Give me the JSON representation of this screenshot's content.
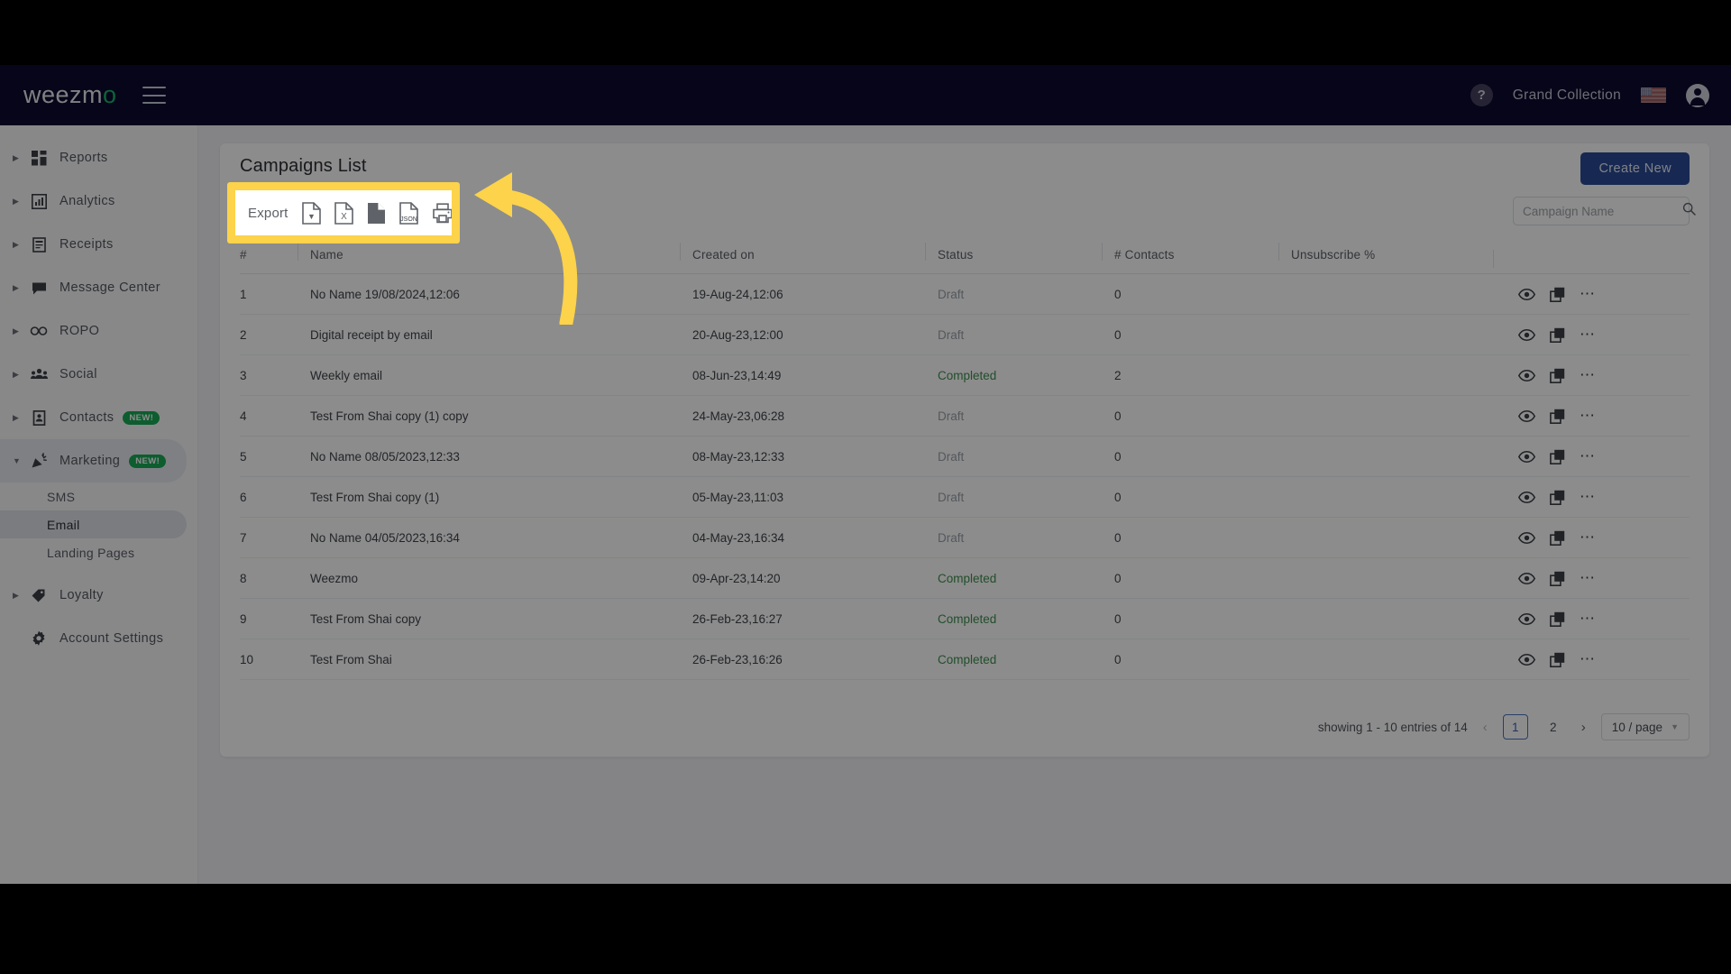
{
  "header": {
    "logo_text": "weezm",
    "logo_accent": "o",
    "menu_icon": "hamburger-icon",
    "help_icon": "?",
    "account_name": "Grand Collection",
    "flag_icon": "us-flag-icon",
    "avatar_icon": "user-avatar-icon"
  },
  "sidebar": {
    "items": [
      {
        "label": "Reports",
        "icon": "grid-icon",
        "expandable": true,
        "badge": ""
      },
      {
        "label": "Analytics",
        "icon": "bar-chart-icon",
        "expandable": true,
        "badge": ""
      },
      {
        "label": "Receipts",
        "icon": "receipt-icon",
        "expandable": true,
        "badge": ""
      },
      {
        "label": "Message Center",
        "icon": "chat-icon",
        "expandable": true,
        "badge": ""
      },
      {
        "label": "ROPO",
        "icon": "infinity-icon",
        "expandable": true,
        "badge": ""
      },
      {
        "label": "Social",
        "icon": "people-icon",
        "expandable": true,
        "badge": ""
      },
      {
        "label": "Contacts",
        "icon": "contact-card-icon",
        "expandable": true,
        "badge": "NEW!"
      },
      {
        "label": "Marketing",
        "icon": "megaphone-icon",
        "expandable": true,
        "badge": "NEW!"
      }
    ],
    "marketing_children": [
      {
        "label": "SMS",
        "active": false
      },
      {
        "label": "Email",
        "active": true
      },
      {
        "label": "Landing Pages",
        "active": false
      }
    ],
    "items_after": [
      {
        "label": "Loyalty",
        "icon": "tag-icon",
        "expandable": true,
        "badge": ""
      },
      {
        "label": "Account Settings",
        "icon": "gear-icon",
        "expandable": false,
        "badge": ""
      }
    ]
  },
  "main": {
    "title": "Campaigns List",
    "create_button": "Create New",
    "search": {
      "value": "",
      "placeholder": "Campaign Name",
      "icon": "search-icon"
    },
    "export": {
      "label": "Export",
      "buttons": [
        {
          "name": "export-pdf-button",
          "icon": "pdf-file-icon",
          "glyph": "PDF"
        },
        {
          "name": "export-excel-button",
          "icon": "excel-file-icon",
          "glyph": "X"
        },
        {
          "name": "export-csv-button",
          "icon": "csv-file-icon",
          "glyph": ""
        },
        {
          "name": "export-json-button",
          "icon": "json-file-icon",
          "glyph": "JSON"
        },
        {
          "name": "print-button",
          "icon": "printer-icon",
          "glyph": ""
        }
      ]
    },
    "table": {
      "columns": [
        "#",
        "Name",
        "Created on",
        "Status",
        "# Contacts",
        "Unsubscribe %",
        ""
      ],
      "rows": [
        {
          "num": "1",
          "name": "No Name 19/08/2024,12:06",
          "created": "19-Aug-24,12:06",
          "status": "Draft",
          "contacts": "0"
        },
        {
          "num": "2",
          "name": "Digital receipt by email",
          "created": "20-Aug-23,12:00",
          "status": "Draft",
          "contacts": "0"
        },
        {
          "num": "3",
          "name": "Weekly email",
          "created": "08-Jun-23,14:49",
          "status": "Completed",
          "contacts": "2"
        },
        {
          "num": "4",
          "name": "Test From Shai copy (1) copy",
          "created": "24-May-23,06:28",
          "status": "Draft",
          "contacts": "0"
        },
        {
          "num": "5",
          "name": "No Name 08/05/2023,12:33",
          "created": "08-May-23,12:33",
          "status": "Draft",
          "contacts": "0"
        },
        {
          "num": "6",
          "name": "Test From Shai copy (1)",
          "created": "05-May-23,11:03",
          "status": "Draft",
          "contacts": "0"
        },
        {
          "num": "7",
          "name": "No Name 04/05/2023,16:34",
          "created": "04-May-23,16:34",
          "status": "Draft",
          "contacts": "0"
        },
        {
          "num": "8",
          "name": "Weezmo",
          "created": "09-Apr-23,14:20",
          "status": "Completed",
          "contacts": "0"
        },
        {
          "num": "9",
          "name": "Test From Shai copy",
          "created": "26-Feb-23,16:27",
          "status": "Completed",
          "contacts": "0"
        },
        {
          "num": "10",
          "name": "Test From Shai",
          "created": "26-Feb-23,16:26",
          "status": "Completed",
          "contacts": "0"
        }
      ],
      "row_actions": [
        {
          "name": "preview-icon",
          "icon": "eye-icon"
        },
        {
          "name": "duplicate-icon",
          "icon": "copy-icon"
        },
        {
          "name": "more-icon",
          "icon": "ellipsis-icon"
        }
      ]
    },
    "pagination": {
      "summary": "showing 1 - 10 entries of 14",
      "prev_icon": "chevron-left-icon",
      "next_icon": "chevron-right-icon",
      "pages": [
        "1",
        "2"
      ],
      "active_page": "1",
      "page_size": "10 / page",
      "page_size_chevron": "chevron-down-icon"
    }
  },
  "annotation": {
    "highlight_color": "#fcd34a",
    "arrow_name": "pointer-arrow",
    "target": "export-toolbar"
  },
  "colors": {
    "header_bg": "#0c0a2e",
    "brand_green": "#19b56b",
    "primary_blue": "#2b4b95",
    "status_completed": "#3f8f4f",
    "status_draft": "#9aa0a8",
    "badge_new": "#18a957",
    "highlight_yellow": "#fcd34a"
  }
}
